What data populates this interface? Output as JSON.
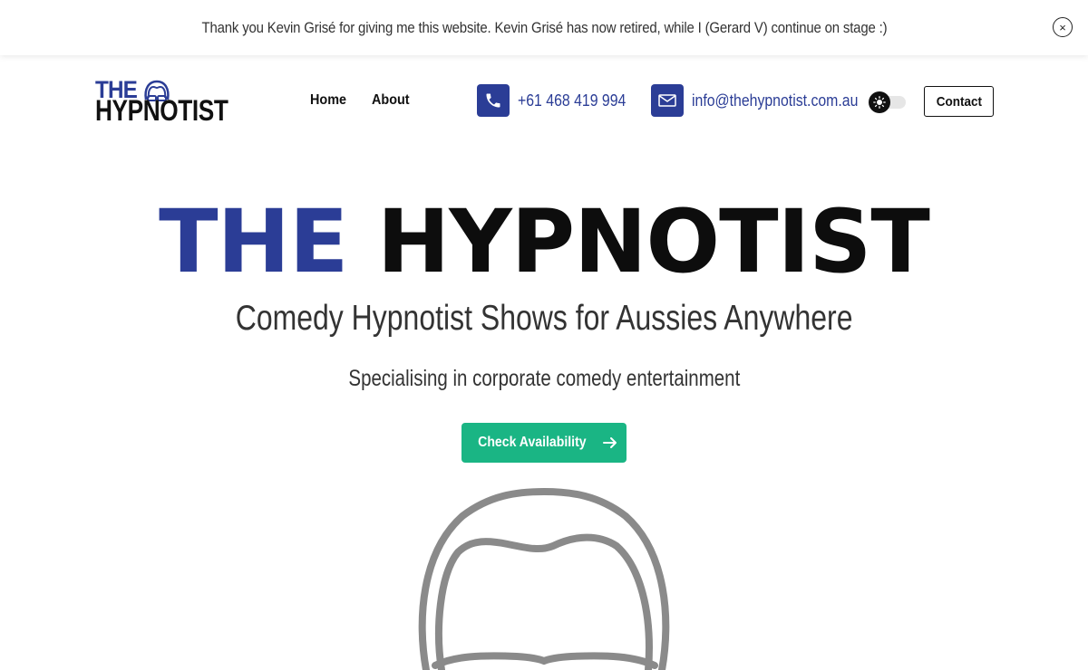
{
  "banner": {
    "text": "Thank you Kevin Grisé for giving me this website. Kevin Grisé has now retired, while I (Gerard V) continue on stage :)",
    "close_label": "×"
  },
  "header": {
    "logo": {
      "line1": "THE",
      "line2": "HYPNOTIST"
    },
    "nav": [
      {
        "label": "Home"
      },
      {
        "label": "About"
      }
    ],
    "phone": {
      "label": "+61 468 419 994",
      "icon": "phone-icon"
    },
    "email": {
      "label": "info@thehypnotist.com.au",
      "icon": "envelope-icon"
    },
    "theme_toggle": {
      "icon": "sun-icon",
      "state": "light"
    },
    "contact_button": "Contact"
  },
  "hero": {
    "title_part1": "THE",
    "title_part2": "HYPNOTIST",
    "subtitle": "Comedy Hypnotist Shows for Aussies Anywhere",
    "tagline": "Specialising in corporate comedy entertainment",
    "cta_label": "Check Availability",
    "cta_icon": "arrow-right-icon",
    "art": "hypnotist-head-illustration"
  },
  "colors": {
    "brand_blue": "#2b3d96",
    "cta_green": "#1ab584",
    "text_dark": "#111111",
    "illustration_gray": "#8a8a8a"
  }
}
